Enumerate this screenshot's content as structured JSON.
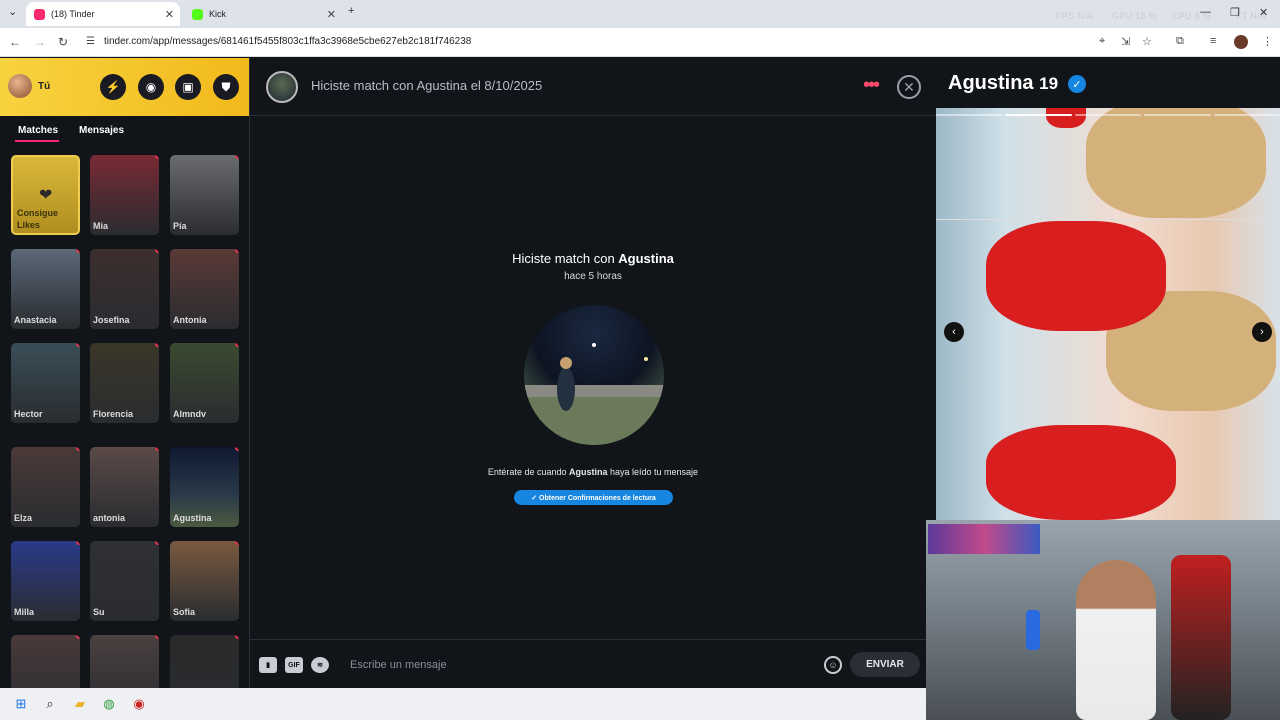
{
  "browser": {
    "tabs": [
      {
        "title": "(18) Tinder",
        "active": true,
        "favicon_color": "#fd2a6b"
      },
      {
        "title": "Kick",
        "active": false,
        "favicon_color": "#53fc18"
      }
    ],
    "new_tab": "+",
    "url": "tinder.com/app/messages/681461f5455f803c1ffa3c3968e5cbe627eb2c181f746238",
    "overlay": {
      "fps_label": "FPS",
      "fps_value": "N/A",
      "gpu_label": "GPU",
      "gpu_value": "18 %",
      "cpu_label": "CPU",
      "cpu_value": "8 %",
      "extra_label": "FT",
      "extra_value": "N/A"
    }
  },
  "sidebar": {
    "me_label": "Tú",
    "header_buttons": [
      "bolt-icon",
      "compass-icon",
      "briefcase-icon",
      "shield-icon"
    ],
    "tabs": [
      {
        "label": "Matches",
        "active": true
      },
      {
        "label": "Mensajes",
        "active": false
      }
    ],
    "likes_card_label": "Consigue Likes",
    "matches": [
      {
        "name": "Mia",
        "color": "#7a2a35"
      },
      {
        "name": "Pía",
        "color": "#6a6c72"
      },
      {
        "name": "Anastacia",
        "color": "#5a6878"
      },
      {
        "name": "Josefina",
        "color": "#3c2e2e"
      },
      {
        "name": "Antonia",
        "color": "#5a3a36"
      },
      {
        "name": "Hector",
        "color": "#3a4e58"
      },
      {
        "name": "Florencia",
        "color": "#3a3628"
      },
      {
        "name": "Almndv",
        "color": "#3a4a30"
      },
      {
        "name": "Elza",
        "color": "#4a3a38"
      },
      {
        "name": "antonia",
        "color": "#5a4a48"
      },
      {
        "name": "Agustina",
        "color": "#1a2a3a"
      },
      {
        "name": "Milla",
        "color": "#2a3a8a"
      },
      {
        "name": "Su",
        "color": "#2e3036"
      },
      {
        "name": "Sofia",
        "color": "#7a5a40"
      },
      {
        "name": "",
        "color": "#4a3a3a"
      },
      {
        "name": "",
        "color": "#4a4040"
      },
      {
        "name": "",
        "color": "#2a2a2a"
      }
    ]
  },
  "chat": {
    "header_title": "Hiciste match con Agustina el 8/10/2025",
    "match_prefix": "Hiciste match con ",
    "match_name": "Agustina",
    "match_time": "hace 5 horas",
    "read_prefix": "Entérate de cuando ",
    "read_name": "Agustina",
    "read_suffix": " haya leído tu mensaje",
    "read_button": "✓ Obtener Confirmaciones de lectura",
    "composer": {
      "gif_label": "GIF",
      "placeholder": "Escribe un mensaje",
      "send_label": "ENVIAR"
    }
  },
  "profile": {
    "name": "Agustina",
    "age": "19",
    "photo_count": 5,
    "active_photo": 2
  }
}
